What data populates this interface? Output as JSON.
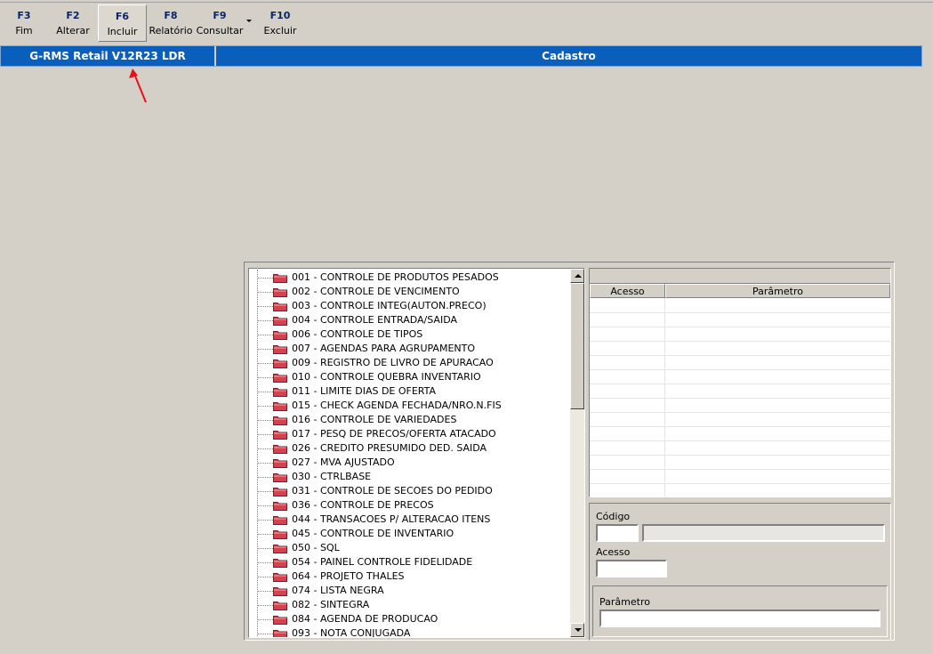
{
  "toolbar": {
    "buttons": [
      {
        "key": "F3",
        "label": "Fim"
      },
      {
        "key": "F2",
        "label": "Alterar"
      },
      {
        "key": "F6",
        "label": "Incluir"
      },
      {
        "key": "F8",
        "label": "Relatório"
      },
      {
        "key": "F9",
        "label": "Consultar"
      },
      {
        "key": "F10",
        "label": "Excluir"
      }
    ]
  },
  "titlebar": {
    "app_title": "G-RMS Retail V12R23 LDR",
    "screen_title": "Cadastro"
  },
  "tree": {
    "items": [
      "001 - CONTROLE DE PRODUTOS PESADOS",
      "002 - CONTROLE DE VENCIMENTO",
      "003 - CONTROLE INTEG(AUTON.PRECO)",
      "004 - CONTROLE ENTRADA/SAIDA",
      "006 - CONTROLE DE TIPOS",
      "007 - AGENDAS PARA AGRUPAMENTO",
      "009 - REGISTRO DE LIVRO DE APURACAO",
      "010 - CONTROLE QUEBRA INVENTARIO",
      "011 - LIMITE DIAS DE OFERTA",
      "015 - CHECK AGENDA FECHADA/NRO.N.FIS",
      "016 - CONTROLE DE VARIEDADES",
      "017 - PESQ DE PRECOS/OFERTA ATACADO",
      "026 - CREDITO PRESUMIDO DED. SAIDA",
      "027 - MVA AJUSTADO",
      "030 - CTRLBASE",
      "031 - CONTROLE DE SECOES DO PEDIDO",
      "036 - CONTROLE DE PRECOS",
      "044 - TRANSACOES P/ ALTERACAO ITENS",
      "045 - CONTROLE DE INVENTARIO",
      "050 - SQL",
      "054 - PAINEL CONTROLE FIDELIDADE",
      "064 - PROJETO THALES",
      "074 - LISTA NEGRA",
      "082 - SINTEGRA",
      "084 - AGENDA DE PRODUCAO",
      "093 - NOTA CONJUGADA"
    ]
  },
  "grid": {
    "columns": [
      "Acesso",
      "Parâmetro"
    ]
  },
  "form": {
    "codigo_label": "Código",
    "codigo_value": "",
    "codigo_desc_value": "",
    "acesso_label": "Acesso",
    "acesso_value": "",
    "parametro_label": "Parâmetro",
    "parametro_value": ""
  },
  "colors": {
    "titlebar_bg": "#0a5fbd",
    "window_bg": "#d4d0c8",
    "toolbar_key": "#0a246a",
    "folder": "#d9404e",
    "annotation_arrow": "#e8101a"
  }
}
